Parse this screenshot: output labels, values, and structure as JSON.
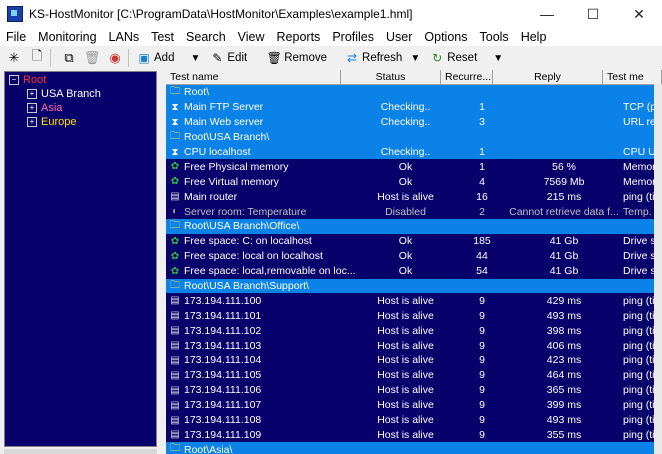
{
  "window": {
    "title": "KS-HostMonitor  [C:\\ProgramData\\HostMonitor\\Examples\\example1.hml]",
    "minimize": "—",
    "maximize": "☐",
    "close": "✕"
  },
  "menu": [
    "File",
    "Monitoring",
    "LANs",
    "Test",
    "Search",
    "View",
    "Reports",
    "Profiles",
    "User",
    "Options",
    "Tools",
    "Help"
  ],
  "toolbar": {
    "add": "Add",
    "edit": "Edit",
    "remove": "Remove",
    "refresh": "Refresh",
    "reset": "Reset"
  },
  "tree": {
    "root": "Root",
    "children": [
      "USA Branch",
      "Asia",
      "Europe"
    ]
  },
  "colors": {
    "grid_bg": "#08006b",
    "folder_row": "#0a82e8",
    "status_alive": "#ffffff",
    "status_checking": "#7fd0ff"
  },
  "columns": [
    "Test name",
    "Status",
    "Recurre...",
    "Reply",
    "Test me"
  ],
  "rows": [
    {
      "kind": "folder",
      "name": "Root\\"
    },
    {
      "kind": "test",
      "icon": "hourglass",
      "name": "Main FTP Server",
      "status": "Checking..",
      "rec": "1",
      "reply": "",
      "method": "TCP (po",
      "sel": true
    },
    {
      "kind": "test",
      "icon": "hourglass",
      "name": "Main Web server",
      "status": "Checking..",
      "rec": "3",
      "reply": "",
      "method": "URL req",
      "sel": true
    },
    {
      "kind": "folder",
      "name": "Root\\USA Branch\\"
    },
    {
      "kind": "test",
      "icon": "hourglass",
      "name": "CPU localhost",
      "status": "Checking..",
      "rec": "1",
      "reply": "",
      "method": "CPU Us",
      "sel": true
    },
    {
      "kind": "test",
      "icon": "ok",
      "name": "Free Physical memory",
      "status": "Ok",
      "rec": "1",
      "reply": "56 %",
      "method": "Memory"
    },
    {
      "kind": "test",
      "icon": "ok",
      "name": "Free Virtual memory",
      "status": "Ok",
      "rec": "4",
      "reply": "7569 Mb",
      "method": "Memory"
    },
    {
      "kind": "test",
      "icon": "host",
      "name": "Main router",
      "status": "Host is alive",
      "rec": "16",
      "reply": "215 ms",
      "method": "ping (tim"
    },
    {
      "kind": "test",
      "icon": "disabled",
      "name": "Server room: Temperature",
      "status": "Disabled",
      "rec": "2",
      "reply": "Cannot retrieve data f...",
      "method": "Temp. m",
      "dim": true
    },
    {
      "kind": "folder",
      "name": "Root\\USA Branch\\Office\\"
    },
    {
      "kind": "test",
      "icon": "ok",
      "name": "Free space: C: on localhost",
      "status": "Ok",
      "rec": "185",
      "reply": "41 Gb",
      "method": "Drive sp"
    },
    {
      "kind": "test",
      "icon": "ok",
      "name": "Free space: local on localhost",
      "status": "Ok",
      "rec": "44",
      "reply": "41 Gb",
      "method": "Drive sp"
    },
    {
      "kind": "test",
      "icon": "ok",
      "name": "Free space: local,removable on loc...",
      "status": "Ok",
      "rec": "54",
      "reply": "41 Gb",
      "method": "Drive sp"
    },
    {
      "kind": "folder",
      "name": "Root\\USA Branch\\Support\\"
    },
    {
      "kind": "test",
      "icon": "host",
      "name": "173.194.111.100",
      "status": "Host is alive",
      "rec": "9",
      "reply": "429 ms",
      "method": "ping (tim"
    },
    {
      "kind": "test",
      "icon": "host",
      "name": "173.194.111.101",
      "status": "Host is alive",
      "rec": "9",
      "reply": "493 ms",
      "method": "ping (tim"
    },
    {
      "kind": "test",
      "icon": "host",
      "name": "173.194.111.102",
      "status": "Host is alive",
      "rec": "9",
      "reply": "398 ms",
      "method": "ping (tim"
    },
    {
      "kind": "test",
      "icon": "host",
      "name": "173.194.111.103",
      "status": "Host is alive",
      "rec": "9",
      "reply": "406 ms",
      "method": "ping (tim"
    },
    {
      "kind": "test",
      "icon": "host",
      "name": "173.194.111.104",
      "status": "Host is alive",
      "rec": "9",
      "reply": "423 ms",
      "method": "ping (tim"
    },
    {
      "kind": "test",
      "icon": "host",
      "name": "173.194.111.105",
      "status": "Host is alive",
      "rec": "9",
      "reply": "464 ms",
      "method": "ping (tim"
    },
    {
      "kind": "test",
      "icon": "host",
      "name": "173.194.111.106",
      "status": "Host is alive",
      "rec": "9",
      "reply": "365 ms",
      "method": "ping (tim"
    },
    {
      "kind": "test",
      "icon": "host",
      "name": "173.194.111.107",
      "status": "Host is alive",
      "rec": "9",
      "reply": "399 ms",
      "method": "ping (tim"
    },
    {
      "kind": "test",
      "icon": "host",
      "name": "173.194.111.108",
      "status": "Host is alive",
      "rec": "9",
      "reply": "493 ms",
      "method": "ping (tim"
    },
    {
      "kind": "test",
      "icon": "host",
      "name": "173.194.111.109",
      "status": "Host is alive",
      "rec": "9",
      "reply": "355 ms",
      "method": "ping (tim"
    },
    {
      "kind": "folder",
      "name": "Root\\Asia\\"
    }
  ]
}
